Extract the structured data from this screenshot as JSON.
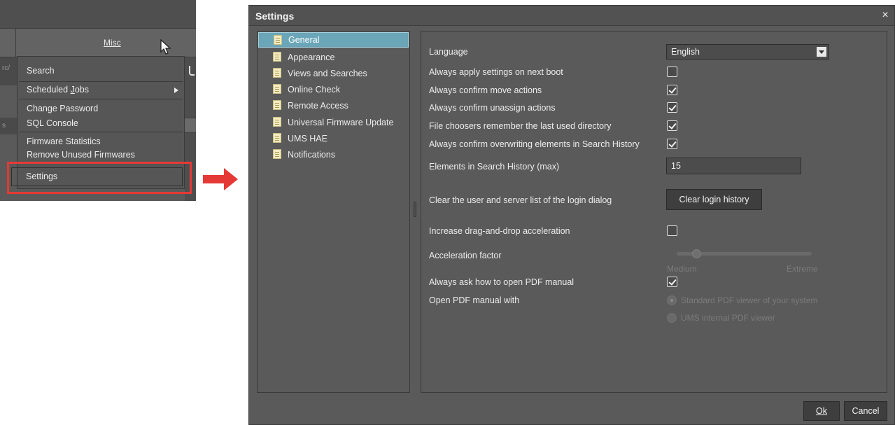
{
  "misc_menu": {
    "menu_label": "Misc",
    "strip_text_top": "rc/",
    "strip_text_mid": "s",
    "items": [
      {
        "label": "Search"
      },
      {
        "label": "Scheduled Jobs"
      },
      {
        "label": "Change Password"
      },
      {
        "label": "SQL Console"
      },
      {
        "label": "Firmware Statistics"
      },
      {
        "label": "Remove Unused Firmwares"
      },
      {
        "label": "Settings"
      }
    ],
    "highlight_color": "#e53935"
  },
  "settings_dialog": {
    "title": "Settings",
    "close_symbol": "×",
    "nav": [
      {
        "label": "General",
        "selected": true
      },
      {
        "label": "Appearance"
      },
      {
        "label": "Views and Searches"
      },
      {
        "label": "Online Check"
      },
      {
        "label": "Remote Access"
      },
      {
        "label": "Universal Firmware Update"
      },
      {
        "label": "UMS HAE"
      },
      {
        "label": "Notifications"
      }
    ],
    "general": {
      "language_label": "Language",
      "language_value": "English",
      "apply_on_next_boot": {
        "label": "Always apply settings on next boot",
        "checked": false
      },
      "confirm_move": {
        "label": "Always confirm move actions",
        "checked": true
      },
      "confirm_unassign": {
        "label": "Always confirm unassign actions",
        "checked": true
      },
      "remember_last_dir": {
        "label": "File choosers remember the last used directory",
        "checked": true
      },
      "confirm_overwrite_history": {
        "label": "Always confirm overwriting elements in Search History",
        "checked": true
      },
      "history_max_label": "Elements in Search History (max)",
      "history_max_value": "15",
      "clear_login_label": "Clear the user and server list of the login dialog",
      "clear_login_button": "Clear login history",
      "drag_drop_accel": {
        "label": "Increase drag-and-drop acceleration",
        "checked": false
      },
      "accel_factor_label": "Acceleration factor",
      "accel_factor_value": 0.15,
      "accel_min_label": "Medium",
      "accel_max_label": "Extreme",
      "ask_pdf": {
        "label": "Always ask how to open PDF manual",
        "checked": true
      },
      "open_pdf_label": "Open PDF manual with",
      "pdf_options": [
        {
          "label": "Standard PDF viewer of your system",
          "selected": true
        },
        {
          "label": "UMS internal PDF viewer",
          "selected": false
        }
      ]
    },
    "ok_button": "Ok",
    "cancel_button": "Cancel"
  }
}
